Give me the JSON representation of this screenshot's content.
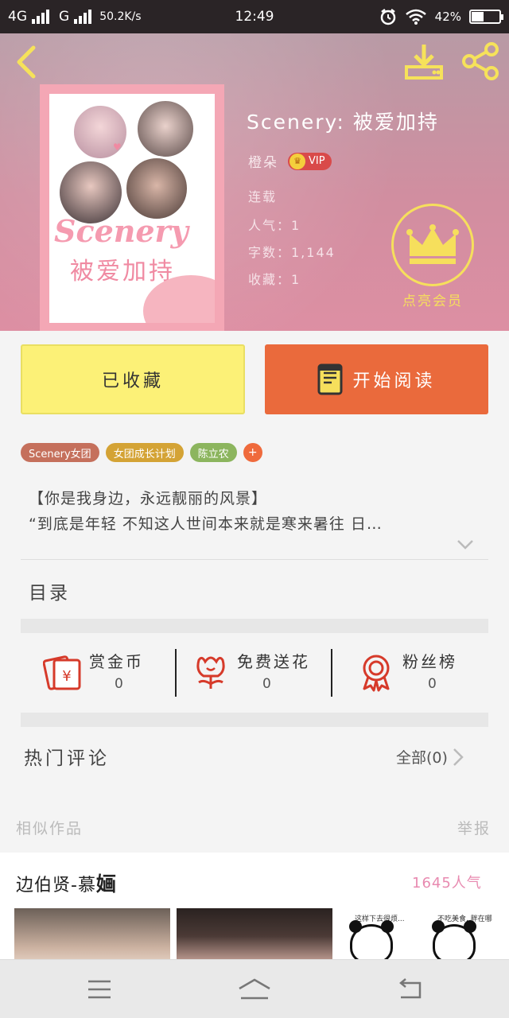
{
  "status_bar": {
    "network1": "4G",
    "network2": "G",
    "speed": "50.2K/s",
    "time": "12:49",
    "battery": "42%"
  },
  "book": {
    "title": "Scenery: 被爱加持",
    "cover_title": "Scenery",
    "cover_subtitle": "被爱加持",
    "author": "橙朵",
    "vip_label": "VIP",
    "status": "连载",
    "popularity": "人气：1",
    "word_count": "字数：1,144",
    "favorites": "收藏：1",
    "member_label": "点亮会员"
  },
  "actions": {
    "collected_label": "已收藏",
    "read_label": "开始阅读"
  },
  "tags": [
    {
      "label": "Scenery女团",
      "color": "#c5705c"
    },
    {
      "label": "女团成长计划",
      "color": "#d4a335"
    },
    {
      "label": "陈立农",
      "color": "#8cb55e"
    }
  ],
  "tag_add": "+",
  "intro": {
    "line1": "【你是我身边，永远靓丽的风景】",
    "line2": "“到底是年轻 不知这人世间本来就是寒来暑往 日…"
  },
  "toc_title": "目录",
  "stats": [
    {
      "label": "赏金币",
      "value": "0",
      "icon": "red-envelope-icon"
    },
    {
      "label": "免费送花",
      "value": "0",
      "icon": "flower-icon"
    },
    {
      "label": "粉丝榜",
      "value": "0",
      "icon": "ribbon-badge-icon"
    }
  ],
  "comments": {
    "title": "热门评论",
    "all_label": "全部(0)"
  },
  "similar": {
    "title": "相似作品",
    "report": "举报"
  },
  "recommendation": {
    "title": "边伯贤-慕",
    "title_emphasis": "婳",
    "popularity": "1645人气",
    "meme_caption_left": "这样下去很烦...",
    "meme_caption_right": "不吃美食, 胖在哪里"
  },
  "colors": {
    "accent_orange": "#ea6a3c",
    "collected_yellow": "#fcf177",
    "member_gold": "#f6df5c",
    "vip_red": "#d94a4a"
  }
}
